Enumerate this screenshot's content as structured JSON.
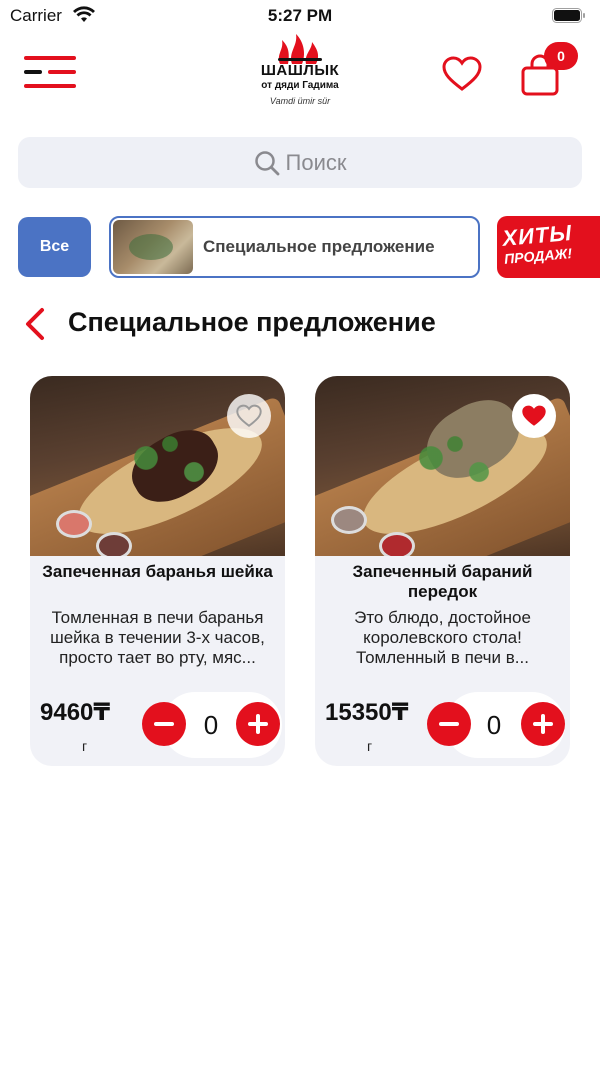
{
  "status_bar": {
    "carrier": "Carrier",
    "time": "5:27 PM"
  },
  "header": {
    "logo": {
      "title": "ШАШЛЫК",
      "subtitle": "от дяди Гадима",
      "script": "Vamdi ümir sür"
    },
    "cart_count": "0",
    "accent_color": "#e3101d"
  },
  "search": {
    "placeholder": "Поиск"
  },
  "categories": {
    "all_label": "Все",
    "special_label": "Специальное предложение",
    "hits_line1": "ХИТЫ",
    "hits_line2": "ПРОДАЖ!",
    "selected_color": "#4b73c4"
  },
  "section": {
    "title": "Специальное предложение"
  },
  "products": [
    {
      "name": "Запеченная баранья шейка",
      "description": "Томленная в печи баранья шейка в течении 3-х часов, просто тает во рту, мяс...",
      "price": "9460₸",
      "unit": "г",
      "quantity": "0",
      "favorite": false
    },
    {
      "name": "Запеченный бараний передок",
      "description": "Это блюдо, достойное королевского стола! Томленный в печи в...",
      "price": "15350₸",
      "unit": "г",
      "quantity": "0",
      "favorite": true
    }
  ]
}
